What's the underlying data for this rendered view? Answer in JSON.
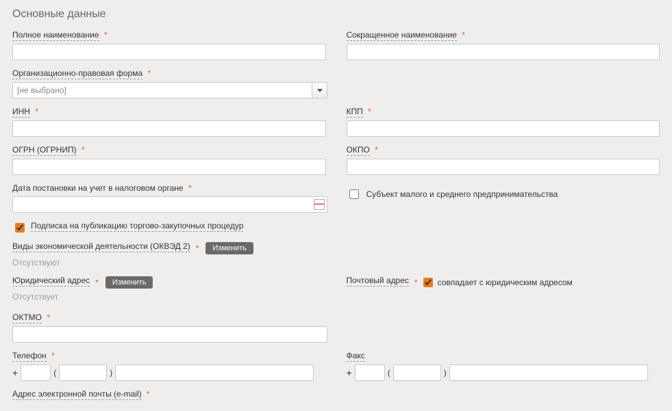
{
  "section_title": "Основные данные",
  "fields": {
    "full_name_label": "Полное наименование",
    "short_name_label": "Сокращенное наименование",
    "legal_form_label": "Организационно-правовая форма",
    "legal_form_placeholder": "[не выбрано]",
    "inn_label": "ИНН",
    "kpp_label": "КПП",
    "ogrn_label": "ОГРН (ОГРНИП)",
    "okpo_label": "ОКПО",
    "reg_date_label": "Дата постановки на учет в налоговом органе",
    "sme_label": "Субъект малого и среднего предпринимательства",
    "subscription_label": "Подписка на публикацию торгово-закупочных процедур",
    "okved_label": "Виды экономической деятельности (ОКВЭД 2)",
    "change_btn": "Изменить",
    "absent_text": "Отсутствуют",
    "absent_text2": "Отсутствует",
    "legal_addr_label": "Юридический адрес",
    "postal_addr_label": "Почтовый адрес",
    "same_as_legal": "совпадает с юридическим адресом",
    "oktmo_label": "ОКТМО",
    "phone_label": "Телефон",
    "fax_label": "Факс",
    "email_label": "Адрес электронной почты (e-mail)",
    "plus": "+",
    "paren_open": "(",
    "paren_close": ")"
  }
}
